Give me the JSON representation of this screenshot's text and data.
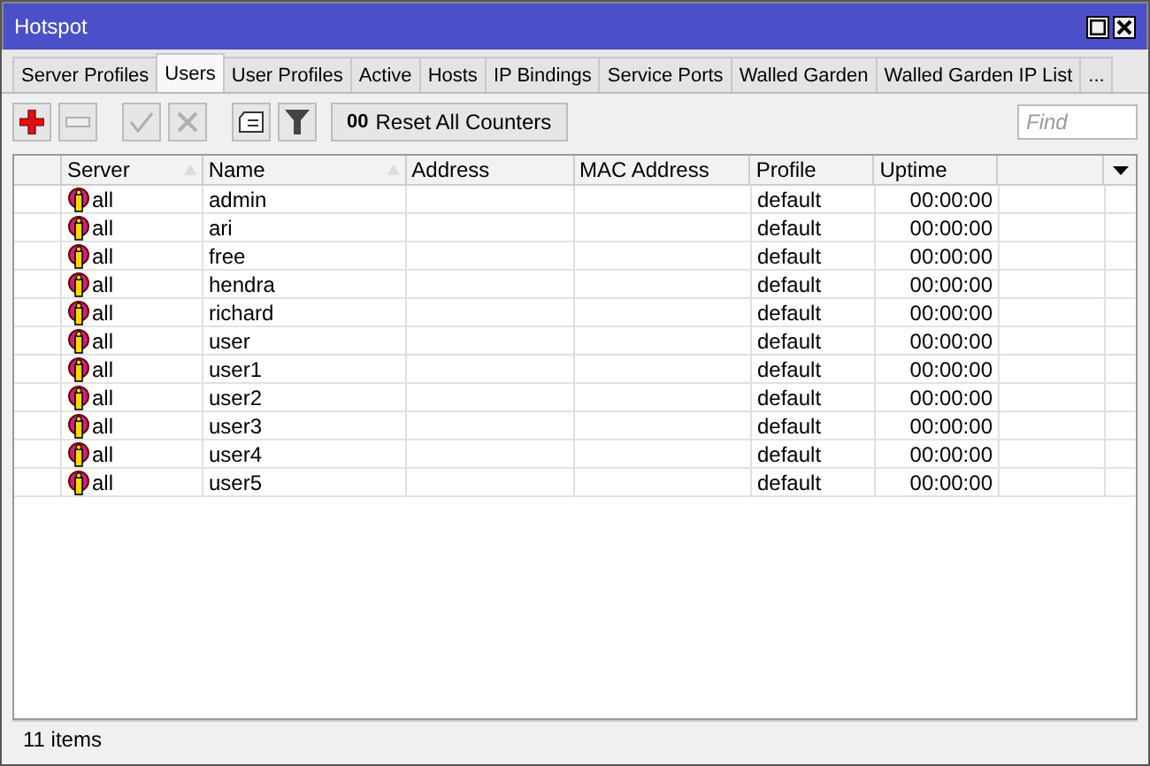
{
  "window": {
    "title": "Hotspot"
  },
  "tabs": [
    {
      "label": "Server Profiles",
      "selected": false
    },
    {
      "label": "Users",
      "selected": true
    },
    {
      "label": "User Profiles",
      "selected": false
    },
    {
      "label": "Active",
      "selected": false
    },
    {
      "label": "Hosts",
      "selected": false
    },
    {
      "label": "IP Bindings",
      "selected": false
    },
    {
      "label": "Service Ports",
      "selected": false
    },
    {
      "label": "Walled Garden",
      "selected": false
    },
    {
      "label": "Walled Garden IP List",
      "selected": false
    },
    {
      "label": "...",
      "selected": false
    }
  ],
  "toolbar": {
    "buttons": [
      {
        "kind": "add",
        "disabled": false
      },
      {
        "kind": "remove",
        "disabled": true
      },
      {
        "kind": "enable",
        "disabled": true
      },
      {
        "kind": "disable",
        "disabled": true
      },
      {
        "kind": "comment",
        "disabled": false
      },
      {
        "kind": "filter",
        "disabled": false
      }
    ],
    "reset_button": {
      "icon_text": "00",
      "label": "Reset All Counters"
    },
    "search": {
      "placeholder": "Find"
    }
  },
  "table": {
    "columns": [
      "Server",
      "Name",
      "Address",
      "MAC Address",
      "Profile",
      "Uptime"
    ],
    "rows": [
      [
        "all",
        "admin",
        "",
        "",
        "default",
        "00:00:00"
      ],
      [
        "all",
        "ari",
        "",
        "",
        "default",
        "00:00:00"
      ],
      [
        "all",
        "free",
        "",
        "",
        "default",
        "00:00:00"
      ],
      [
        "all",
        "hendra",
        "",
        "",
        "default",
        "00:00:00"
      ],
      [
        "all",
        "richard",
        "",
        "",
        "default",
        "00:00:00"
      ],
      [
        "all",
        "user",
        "",
        "",
        "default",
        "00:00:00"
      ],
      [
        "all",
        "user1",
        "",
        "",
        "default",
        "00:00:00"
      ],
      [
        "all",
        "user2",
        "",
        "",
        "default",
        "00:00:00"
      ],
      [
        "all",
        "user3",
        "",
        "",
        "default",
        "00:00:00"
      ],
      [
        "all",
        "user4",
        "",
        "",
        "default",
        "00:00:00"
      ],
      [
        "all",
        "user5",
        "",
        "",
        "default",
        "00:00:00"
      ]
    ]
  },
  "status_bar": "11 items"
}
